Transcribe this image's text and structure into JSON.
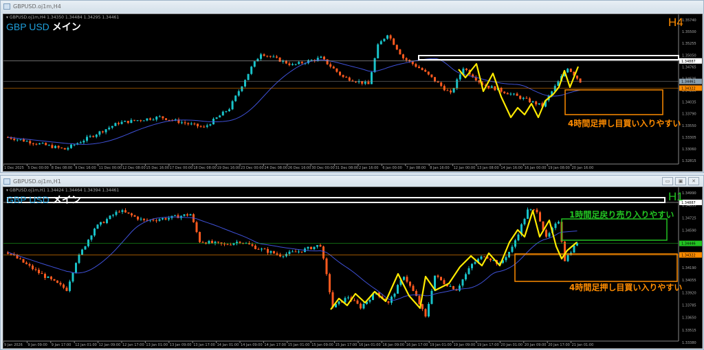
{
  "colors": {
    "bull": "#19c3c9",
    "bear": "#ff5a1f",
    "ma": "#3f51d8",
    "zigzag": "#ffea00",
    "orange": "#ff8c00",
    "green": "#22c322",
    "white": "#ffffff"
  },
  "windows": [
    {
      "title": "GBPUSD.oj1m,H4",
      "ohlc": "▾ GBPUSD.oj1m,H4  1.34350 1.34484 1.34295 1.34461",
      "symbol": "GBP USD",
      "symbol_jp": "メイン",
      "timeframe": "H4",
      "price_scale": [
        "1.35740",
        "1.35500",
        "1.35255",
        "1.35050",
        "1.34765",
        "1.34525",
        "1.34280",
        "1.34035",
        "1.33790",
        "1.33550",
        "1.33305",
        "1.33060",
        "1.32815"
      ],
      "price_range": [
        1.32815,
        1.3574
      ],
      "levels": {
        "resistance": "1.34887",
        "bid": "1.34461",
        "support": "1.34322"
      },
      "time_scale": [
        "1 Dec 2025",
        "5 Dec 00:00",
        "8 Dec 08:00",
        "9 Dec 16:00",
        "11 Dec 00:00",
        "12 Dec 08:00",
        "15 Dec 16:00",
        "17 Dec 00:00",
        "18 Dec 08:00",
        "19 Dec 16:00",
        "23 Dec 00:00",
        "24 Dec 08:00",
        "26 Dec 16:00",
        "30 Dec 00:00",
        "31 Dec 08:00",
        "2 Jan 16:00",
        "6 Jan 00:00",
        "7 Jan 08:00",
        "8 Jan 16:00",
        "12 Jan 00:00",
        "13 Jan 08:00",
        "14 Jan 16:00",
        "16 Jan 00:00",
        "19 Jan 08:00",
        "20 Jan 16:00"
      ],
      "price_path": [
        [
          0,
          1.333
        ],
        [
          18,
          1.3305
        ],
        [
          35,
          1.336
        ],
        [
          48,
          1.3372
        ],
        [
          62,
          1.335
        ],
        [
          70,
          1.339
        ],
        [
          77,
          1.3475
        ],
        [
          80,
          1.3505
        ],
        [
          90,
          1.348
        ],
        [
          99,
          1.3495
        ],
        [
          106,
          1.3455
        ],
        [
          114,
          1.344
        ],
        [
          117,
          1.352
        ],
        [
          120,
          1.3545
        ],
        [
          125,
          1.3495
        ],
        [
          131,
          1.347
        ],
        [
          140,
          1.342
        ],
        [
          144,
          1.3475
        ],
        [
          150,
          1.344
        ],
        [
          159,
          1.342
        ],
        [
          169,
          1.3395
        ],
        [
          177,
          1.3475
        ],
        [
          181,
          1.3446
        ]
      ],
      "notes": [
        {
          "text": "4時間足押し目買い入りやすい",
          "color": "#ff8c00"
        }
      ]
    },
    {
      "title": "GBPUSD.oj1m,H1",
      "ohlc": "▾ GBPUSD.oj1m,H1  1.34424 1.34464 1.34394 1.34461",
      "symbol": "GBP USD",
      "symbol_jp": "メイン",
      "timeframe": "H1",
      "price_scale": [
        "1.34990",
        "1.34855",
        "1.34725",
        "1.34590",
        "1.34455",
        "1.34320",
        "1.34190",
        "1.34055",
        "1.33920",
        "1.33785",
        "1.33650",
        "1.33515",
        "1.33380"
      ],
      "price_range": [
        1.3338,
        1.3499
      ],
      "levels": {
        "resistance": "1.34887",
        "bid": "1.34446",
        "support": "1.34322"
      },
      "time_scale": [
        "9 Jan 2026",
        "9 Jan 09:00",
        "9 Jan 17:00",
        "12 Jan 01:00",
        "12 Jan 09:00",
        "12 Jan 17:00",
        "13 Jan 01:00",
        "13 Jan 09:00",
        "13 Jan 17:00",
        "14 Jan 01:00",
        "14 Jan 09:00",
        "14 Jan 17:00",
        "15 Jan 01:00",
        "15 Jan 09:00",
        "15 Jan 17:00",
        "16 Jan 01:00",
        "16 Jan 09:00",
        "16 Jan 17:00",
        "19 Jan 01:00",
        "19 Jan 09:00",
        "19 Jan 17:00",
        "20 Jan 01:00",
        "20 Jan 09:00",
        "20 Jan 17:00",
        "21 Jan 01:00"
      ],
      "price_path": [
        [
          0,
          1.3435
        ],
        [
          10,
          1.3413
        ],
        [
          19,
          1.3395
        ],
        [
          22,
          1.3425
        ],
        [
          28,
          1.3461
        ],
        [
          36,
          1.348
        ],
        [
          44,
          1.3469
        ],
        [
          52,
          1.3472
        ],
        [
          59,
          1.3476
        ],
        [
          62,
          1.3447
        ],
        [
          70,
          1.3443
        ],
        [
          75,
          1.3447
        ],
        [
          81,
          1.3439
        ],
        [
          88,
          1.3432
        ],
        [
          94,
          1.3436
        ],
        [
          101,
          1.3443
        ],
        [
          103,
          1.341
        ],
        [
          105,
          1.3376
        ],
        [
          110,
          1.3387
        ],
        [
          114,
          1.3376
        ],
        [
          119,
          1.3392
        ],
        [
          123,
          1.338
        ],
        [
          128,
          1.341
        ],
        [
          132,
          1.3387
        ],
        [
          135,
          1.3365
        ],
        [
          138,
          1.341
        ],
        [
          141,
          1.3402
        ],
        [
          145,
          1.3395
        ],
        [
          150,
          1.3422
        ],
        [
          154,
          1.3432
        ],
        [
          159,
          1.3422
        ],
        [
          163,
          1.344
        ],
        [
          168,
          1.348
        ],
        [
          171,
          1.348
        ],
        [
          174,
          1.345
        ],
        [
          178,
          1.3469
        ],
        [
          180,
          1.3427
        ],
        [
          184,
          1.3446
        ]
      ],
      "notes": [
        {
          "text": "1時間足戻り売り入りやすい",
          "color": "#22c322"
        },
        {
          "text": "4時間足押し目買い入りやすい",
          "color": "#ff8c00"
        }
      ]
    }
  ]
}
